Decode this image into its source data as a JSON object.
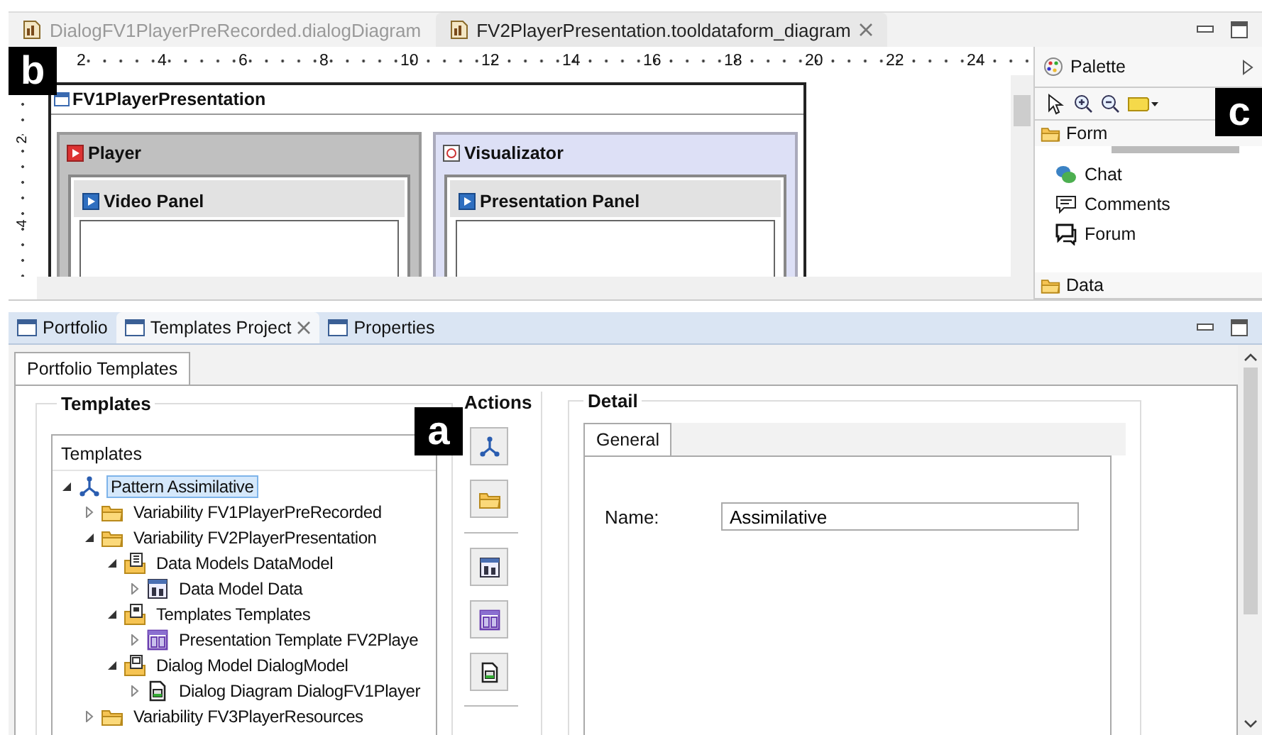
{
  "editor_tabs": [
    {
      "label": "DialogFV1PlayerPreRecorded.dialogDiagram",
      "selected": false,
      "closable": false
    },
    {
      "label": "FV2PlayerPresentation.tooldataform_diagram",
      "selected": true,
      "closable": true
    }
  ],
  "ruler": {
    "marks": [
      "2",
      "4",
      "6",
      "8",
      "10",
      "12",
      "14",
      "16",
      "18",
      "20",
      "22",
      "24"
    ],
    "vertical_marks": [
      "2",
      "4"
    ]
  },
  "diagram": {
    "title": "FV1PlayerPresentation",
    "containers": [
      {
        "title": "Player",
        "kind": "player",
        "panel": "Video Panel"
      },
      {
        "title": "Visualizator",
        "kind": "visualizator",
        "panel": "Presentation Panel"
      }
    ]
  },
  "palette": {
    "title": "Palette",
    "drawers": [
      {
        "label": "Form",
        "expanded": true,
        "items": [
          {
            "label": "Chat",
            "kind": "chat"
          },
          {
            "label": "Comments",
            "kind": "comments"
          },
          {
            "label": "Forum",
            "kind": "forum"
          }
        ]
      },
      {
        "label": "Data",
        "expanded": false
      }
    ]
  },
  "callouts": [
    "b",
    "c",
    "a"
  ],
  "view_tabs": [
    {
      "label": "Portfolio",
      "selected": false,
      "closable": false
    },
    {
      "label": "Templates Project",
      "selected": true,
      "closable": true
    },
    {
      "label": "Properties",
      "selected": false,
      "closable": false
    }
  ],
  "sub_tabs": [
    {
      "label": "Portfolio Templates",
      "selected": true
    }
  ],
  "templates": {
    "title": "Templates",
    "tree_header": "Templates",
    "tree": [
      {
        "label": "Pattern Assimilative",
        "kind": "pattern",
        "expanded": true,
        "selected": true,
        "children": [
          {
            "label": "Variability FV1PlayerPreRecorded",
            "kind": "folder",
            "expanded": false,
            "selected": false
          },
          {
            "label": "Variability FV2PlayerPresentation",
            "kind": "folder",
            "expanded": true,
            "selected": false,
            "children": [
              {
                "label": "Data Models DataModel",
                "kind": "datamodels",
                "expanded": true,
                "selected": false,
                "children": [
                  {
                    "label": "Data Model Data",
                    "kind": "data",
                    "expanded": false,
                    "selected": false
                  }
                ]
              },
              {
                "label": "Templates Templates",
                "kind": "templates",
                "expanded": true,
                "selected": false,
                "children": [
                  {
                    "label": "Presentation Template FV2Playe",
                    "kind": "presentation",
                    "expanded": false,
                    "selected": false
                  }
                ]
              },
              {
                "label": "Dialog Model DialogModel",
                "kind": "dialogmodel",
                "expanded": true,
                "selected": false,
                "children": [
                  {
                    "label": "Dialog Diagram DialogFV1Player",
                    "kind": "dialogdiagram",
                    "expanded": false,
                    "selected": false
                  }
                ]
              }
            ]
          },
          {
            "label": "Variability FV3PlayerResources",
            "kind": "folder",
            "expanded": false,
            "selected": false
          }
        ]
      }
    ]
  },
  "actions": {
    "title": "Actions",
    "buttons": [
      {
        "kind": "pattern"
      },
      {
        "kind": "folder"
      },
      {
        "kind": "data"
      },
      {
        "kind": "presentation"
      },
      {
        "kind": "dialogdiagram"
      }
    ]
  },
  "detail": {
    "title": "Detail",
    "tabs": [
      {
        "label": "General",
        "selected": true
      }
    ],
    "fields": [
      {
        "label": "Name:",
        "value": "Assimilative"
      }
    ]
  }
}
